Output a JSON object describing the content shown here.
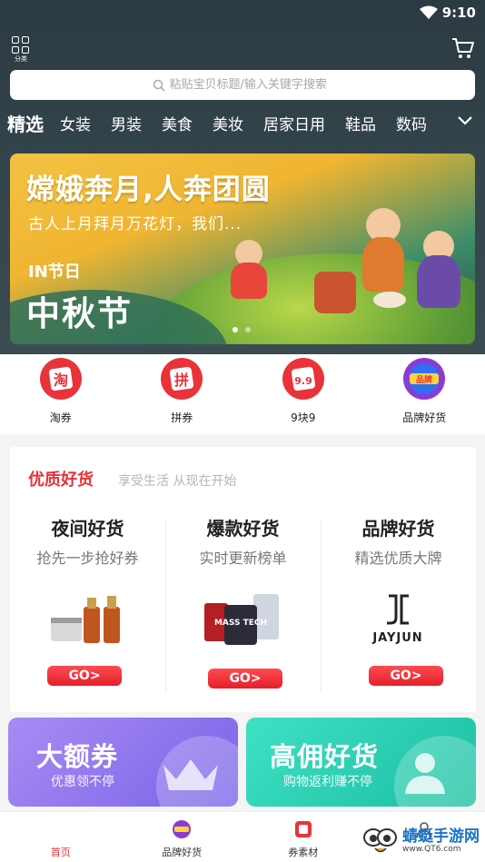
{
  "status": {
    "time": "9:10"
  },
  "header": {
    "category_label": "分类",
    "search_placeholder": "粘贴宝贝标题/输入关键字搜索"
  },
  "categories": [
    "精选",
    "女装",
    "男装",
    "美食",
    "美妆",
    "居家日用",
    "鞋品",
    "数码"
  ],
  "banner": {
    "title": "嫦娥奔月,人奔团圆",
    "subtitle": "古人上月拜月万花灯，我们...",
    "tag": "IN节日",
    "main": "中秋节",
    "slides": 2,
    "active_slide": 1
  },
  "quick": [
    {
      "label": "淘券",
      "glyph": "淘",
      "color": "#e8333a"
    },
    {
      "label": "拼券",
      "glyph": "拼",
      "color": "#e8333a"
    },
    {
      "label": "9块9",
      "glyph": "9.9",
      "color": "#e8333a"
    },
    {
      "label": "品牌好货",
      "glyph": "品牌",
      "color": "#8a3bd6"
    }
  ],
  "premium": {
    "title": "优质好货",
    "subtitle": "享受生活 从现在开始",
    "columns": [
      {
        "title": "夜间好货",
        "sub": "抢先一步抢好券",
        "go": "GO>"
      },
      {
        "title": "爆款好货",
        "sub": "实时更新榜单",
        "go": "GO>"
      },
      {
        "title": "品牌好货",
        "sub": "精选优质大牌",
        "go": "GO>",
        "brand": "JAYJUN"
      }
    ],
    "product_text": "MASS TECH"
  },
  "promos": [
    {
      "title": "大额券",
      "sub": "优惠领不停",
      "color_from": "#a88bf3",
      "color_to": "#7a64e8"
    },
    {
      "title": "高佣好货",
      "sub": "购物返利赚不停",
      "color_from": "#37dcc0",
      "color_to": "#1bbfa4"
    }
  ],
  "bottomnav": [
    {
      "label": "首页",
      "active": true
    },
    {
      "label": "品牌好货",
      "active": false
    },
    {
      "label": "券素材",
      "active": false
    },
    {
      "label": "",
      "active": false
    }
  ],
  "watermark": {
    "name": "蜻蜓手游网",
    "url": "www.QT6.com"
  },
  "colors": {
    "accent": "#e8333a",
    "header_bg": "#33444b"
  }
}
